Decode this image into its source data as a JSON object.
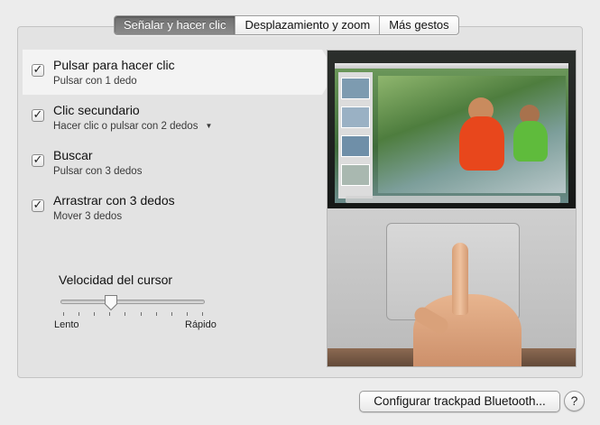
{
  "tabs": [
    {
      "label": "Señalar y hacer clic",
      "active": true
    },
    {
      "label": "Desplazamiento y zoom",
      "active": false
    },
    {
      "label": "Más gestos",
      "active": false
    }
  ],
  "options": [
    {
      "title": "Pulsar para hacer clic",
      "subtitle": "Pulsar con 1 dedo",
      "checked": true,
      "selected": true
    },
    {
      "title": "Clic secundario",
      "subtitle": "Hacer clic o pulsar con 2 dedos",
      "checked": true,
      "has_dropdown": true
    },
    {
      "title": "Buscar",
      "subtitle": "Pulsar con 3 dedos",
      "checked": true
    },
    {
      "title": "Arrastrar con 3 dedos",
      "subtitle": "Mover 3 dedos",
      "checked": true
    }
  ],
  "slider": {
    "label": "Velocidad del cursor",
    "min_label": "Lento",
    "max_label": "Rápido",
    "value_fraction": 0.35,
    "tick_count": 10
  },
  "checkmark_glyph": "✓",
  "dropdown_glyph": "▼",
  "buttons": {
    "bluetooth": "Configurar trackpad Bluetooth...",
    "help": "?"
  },
  "colors": {
    "active_tab": "#7a7a7a",
    "selection": "#f3f3f3",
    "panel": "#e3e3e3"
  }
}
